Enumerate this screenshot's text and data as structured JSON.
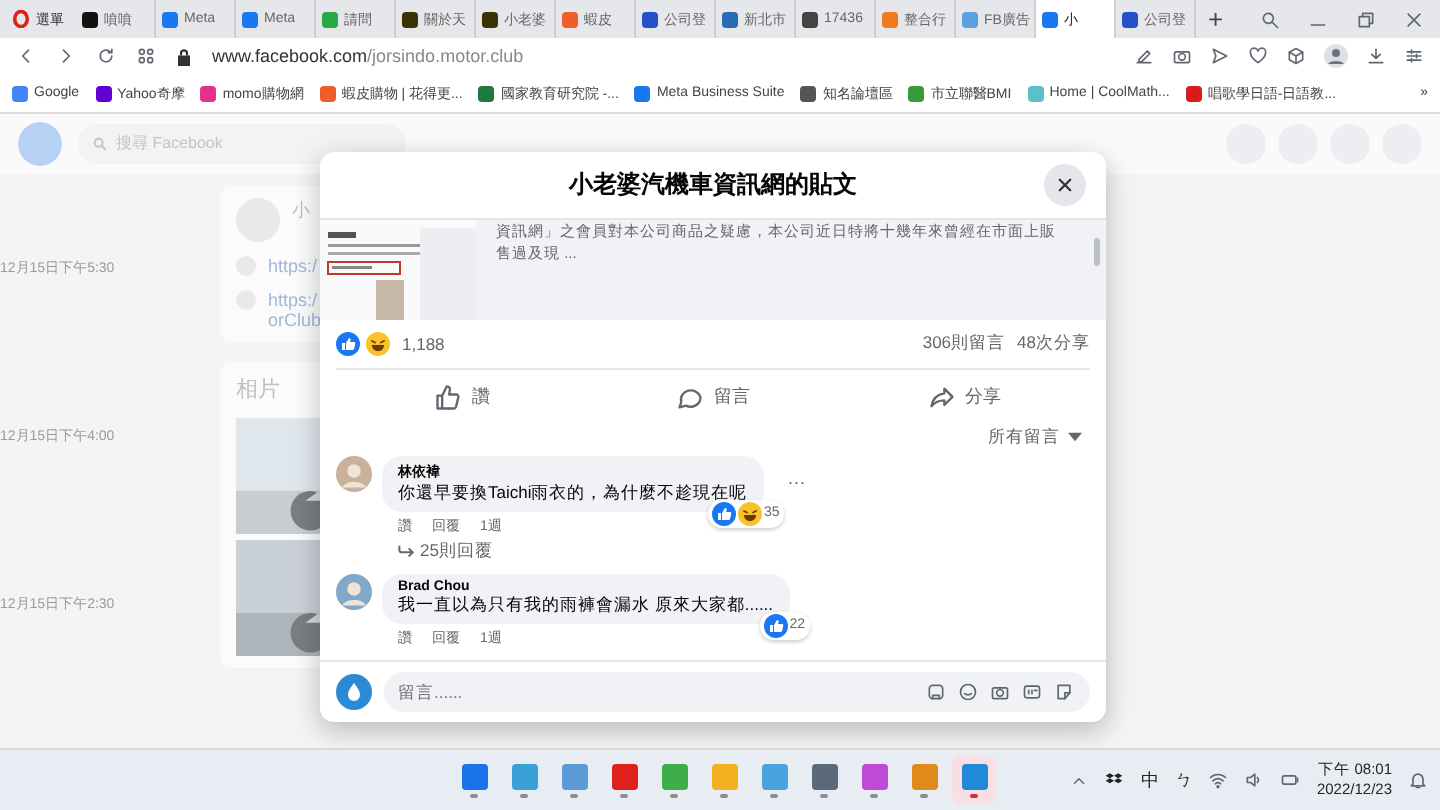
{
  "browser": {
    "menu_label": "選單",
    "tabs": [
      {
        "label": "噴噴",
        "color": "#111111",
        "selected": false
      },
      {
        "label": "Meta",
        "color": "#1877f2",
        "selected": false
      },
      {
        "label": "Meta",
        "color": "#1877f2",
        "selected": false
      },
      {
        "label": "請問",
        "color": "#27a844",
        "selected": false
      },
      {
        "label": "關於天",
        "color": "#3a3200",
        "selected": false
      },
      {
        "label": "小老婆",
        "color": "#3a3200",
        "selected": false
      },
      {
        "label": "蝦皮",
        "color": "#f05d2c",
        "selected": false
      },
      {
        "label": "公司登",
        "color": "#2250c8",
        "selected": false
      },
      {
        "label": "新北市",
        "color": "#2a6bb5",
        "selected": false
      },
      {
        "label": "17436",
        "color": "#444444",
        "selected": false
      },
      {
        "label": "整合行",
        "color": "#f07a1a",
        "selected": false
      },
      {
        "label": "FB廣告",
        "color": "#5aa0e0",
        "selected": false
      },
      {
        "label": "小",
        "color": "#1877f2",
        "selected": true
      },
      {
        "label": "公司登",
        "color": "#2250c8",
        "selected": false
      }
    ],
    "new_tab": "+",
    "url_host": "www.facebook.com",
    "url_path": "/jorsindo.motor.club",
    "bookmarks": [
      {
        "label": "Google",
        "color": "#4285f4"
      },
      {
        "label": "Yahoo奇摩",
        "color": "#6001d2"
      },
      {
        "label": "momo購物網",
        "color": "#e5308b"
      },
      {
        "label": "蝦皮購物 | 花得更...",
        "color": "#f05d2c"
      },
      {
        "label": "國家教育研究院 -...",
        "color": "#1d7a3a"
      },
      {
        "label": "Meta Business Suite",
        "color": "#1877f2"
      },
      {
        "label": "知名論壇區",
        "color": "#555555"
      },
      {
        "label": "市立聯醫BMI",
        "color": "#3a9a3a"
      },
      {
        "label": "Home | CoolMath...",
        "color": "#5bc0c8"
      },
      {
        "label": "唱歌學日語-日語教...",
        "color": "#d81b1b"
      }
    ],
    "more_bookmarks": "»"
  },
  "page": {
    "search_placeholder": "搜尋 Facebook",
    "timestamps": [
      "12月15日下午5:30",
      "12月15日下午4:00",
      "12月15日下午2:30"
    ],
    "page_name": "小",
    "links": [
      [
        "https:/"
      ],
      [
        "https:/",
        "orClub"
      ]
    ],
    "photos_heading": "相片"
  },
  "modal": {
    "title": "小老婆汽機車資訊網的貼文",
    "excerpt": [
      "資訊網」之會員對本公司商品之疑慮，本公司近日特將十幾年來曾經在市面上販",
      "售過及現 ..."
    ],
    "reactions": [
      {
        "kind": "like"
      },
      {
        "kind": "haha"
      }
    ],
    "reaction_count": "1,188",
    "comment_count": "306則留言",
    "share_count": "48次分享",
    "actions": [
      {
        "kind": "like",
        "label": "讚"
      },
      {
        "kind": "comment",
        "label": "留言"
      },
      {
        "kind": "share",
        "label": "分享"
      }
    ],
    "sort": "所有留言",
    "comments": [
      {
        "name": "林依褘",
        "text": "你還早要換Taichi雨衣的，為什麼不趁現在呢",
        "reactions": [
          {
            "kind": "like"
          },
          {
            "kind": "haha"
          }
        ],
        "reaction_count": "35",
        "actions": [
          "讚",
          "回覆",
          "1週"
        ],
        "more_button": "···",
        "replies": "25則回覆"
      },
      {
        "name": "Brad Chou",
        "text": "我一直以為只有我的雨褲會漏水 原來大家都......",
        "reactions": [
          {
            "kind": "like"
          }
        ],
        "reaction_count": "22",
        "actions": [
          "讚",
          "回覆",
          "1週"
        ]
      }
    ],
    "composer_placeholder": "留言......"
  },
  "taskbar": {
    "apps": [
      {
        "color": "#1a73e8",
        "selected": false
      },
      {
        "color": "#3aa0d8",
        "selected": false
      },
      {
        "color": "#5b9bd5",
        "selected": false
      },
      {
        "color": "#e0201b",
        "selected": false
      },
      {
        "color": "#3fae49",
        "selected": false
      },
      {
        "color": "#f2b01e",
        "selected": false
      },
      {
        "color": "#4aa3df",
        "selected": false
      },
      {
        "color": "#5a6a7a",
        "selected": false
      },
      {
        "color": "#c04ad8",
        "selected": false
      },
      {
        "color": "#e08a1a",
        "selected": false
      },
      {
        "color": "#1f8ad8",
        "selected": true
      }
    ],
    "ime": "中",
    "ime_mode": "ㄅ",
    "time": "下午 08:01",
    "date": "2022/12/23"
  }
}
